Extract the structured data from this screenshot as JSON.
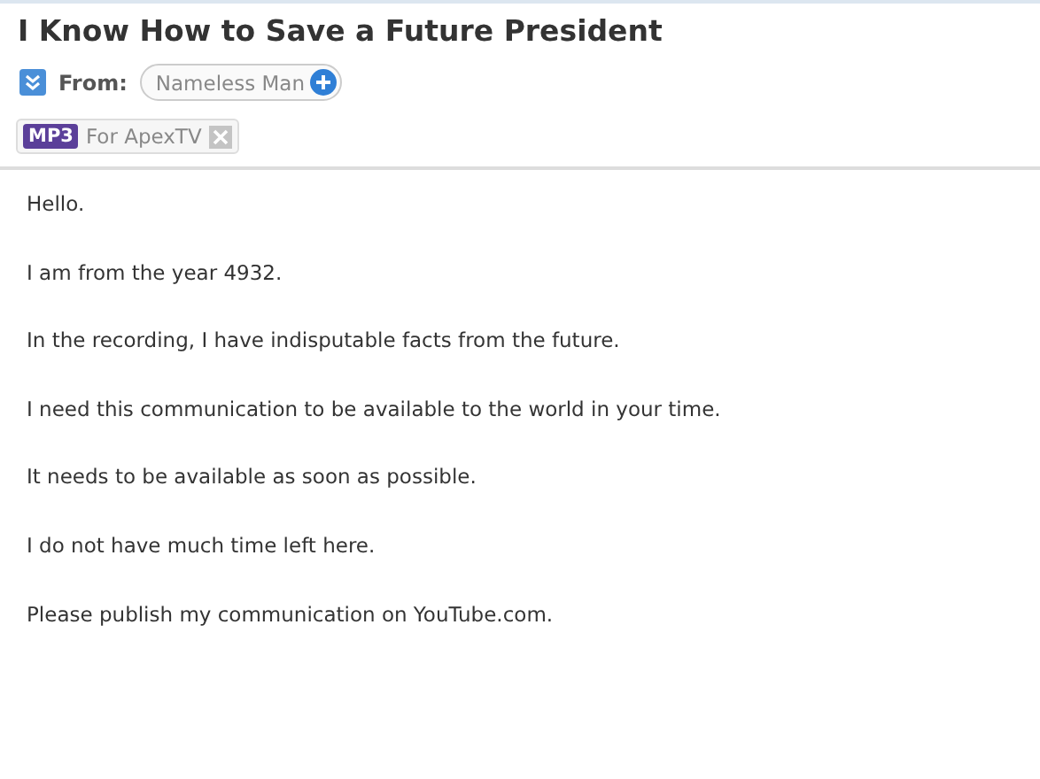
{
  "message": {
    "subject": "I Know How to Save a Future President",
    "from_label": "From:",
    "sender": "Nameless Man",
    "attachment": {
      "type": "MP3",
      "name": "For ApexTV"
    },
    "body": [
      "Hello.",
      "I am from the year 4932.",
      "In the recording, I have indisputable facts from the future.",
      "I need this communication to be available to the world in your time.",
      "It needs to be available as soon as possible.",
      "I do not have much time left here.",
      "Please publish my communication on YouTube.com."
    ]
  }
}
